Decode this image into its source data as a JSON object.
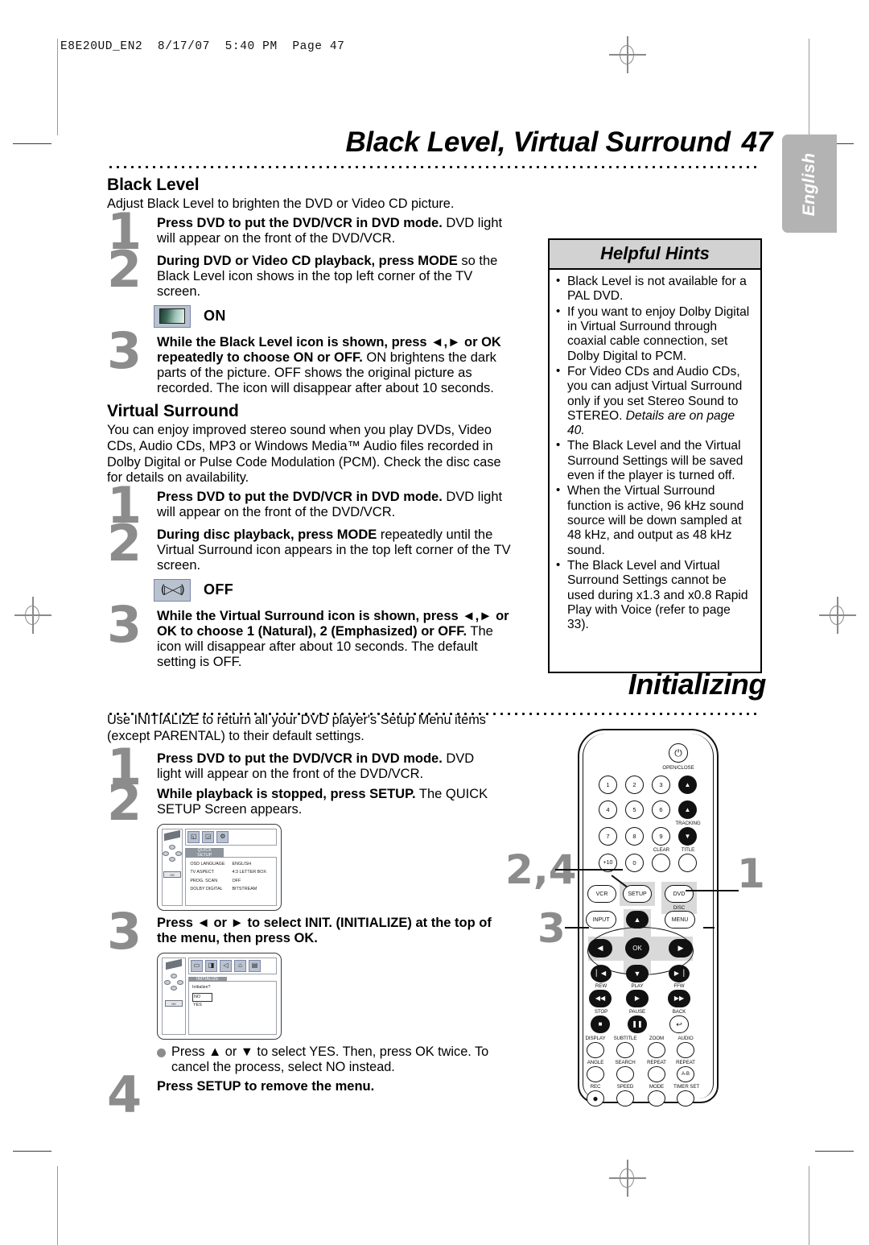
{
  "print_stamp": "E8E20UD_EN2  8/17/07  5:40 PM  Page 47",
  "lang_tab": "English",
  "header": {
    "title": "Black Level, Virtual Surround",
    "page_number": "47"
  },
  "black_level": {
    "heading": "Black Level",
    "intro": "Adjust Black Level to brighten the DVD or Video CD picture.",
    "steps": [
      {
        "num": "1",
        "bold": "Press DVD to put the DVD/VCR in DVD mode.",
        "text": "DVD light will appear on the front of the DVD/VCR."
      },
      {
        "num": "2",
        "bold": "During DVD or Video CD playback, press MODE",
        "text": "so the Black Level icon shows in the top left corner of the TV screen."
      },
      {
        "num": "3",
        "bold": "While the Black Level icon is shown, press ◄,► or OK repeatedly to choose ON or OFF.",
        "text": "ON brightens the dark parts of the picture. OFF shows the original picture as recorded. The icon will disappear after about 10 seconds."
      }
    ],
    "osd_icon_label": "ON",
    "osd_icon_name": "black-level-icon"
  },
  "virtual_surround": {
    "heading": "Virtual Surround",
    "intro": "You can enjoy improved stereo sound when you play DVDs, Video CDs, Audio CDs, MP3 or Windows Media™ Audio files recorded in Dolby Digital or Pulse Code Modulation (PCM). Check the disc case for details on availability.",
    "steps": [
      {
        "num": "1",
        "bold": "Press DVD to put the DVD/VCR in DVD mode.",
        "text": "DVD light will appear on the front of the DVD/VCR."
      },
      {
        "num": "2",
        "bold": "During disc playback, press MODE",
        "text": "repeatedly until the Virtual Surround icon appears in the top left corner of the TV screen."
      },
      {
        "num": "3",
        "bold": "While the Virtual Surround icon is shown, press ◄,► or OK to choose 1 (Natural), 2 (Emphasized) or OFF.",
        "text": "The icon will disappear after about 10 seconds. The default setting is OFF."
      }
    ],
    "osd_icon_label": "OFF",
    "osd_icon_glyph": "(▷◁)"
  },
  "helpful_hints": {
    "title": "Helpful Hints",
    "items": [
      "Black Level is not available for a PAL DVD.",
      "If you want to enjoy Dolby Digital in Virtual Surround through coaxial cable connection, set Dolby Digital to PCM.",
      "For Video CDs and Audio CDs, you can adjust Virtual Surround only if you set Stereo Sound to STEREO.",
      "The Black Level and the Virtual Surround Settings will be saved even if the player is turned off.",
      "When the Virtual Surround function is active, 96 kHz sound source will be down sampled at 48 kHz, and output as 48 kHz sound.",
      "The Black Level and Virtual Surround Settings cannot be used during x1.3 and x0.8 Rapid Play with Voice (refer to page 33)."
    ],
    "italic_note": "Details are on page 40.",
    "italic_note_after_item": 2
  },
  "initializing": {
    "title": "Initializing",
    "intro": "Use INITIALIZE to return all your DVD player's Setup Menu items (except PARENTAL) to their default settings.",
    "steps": [
      {
        "num": "1",
        "bold": "Press DVD to put the DVD/VCR in DVD mode.",
        "text": "DVD light will appear on the front of the DVD/VCR."
      },
      {
        "num": "2",
        "bold": "While playback is stopped, press SETUP.",
        "text": "The QUICK SETUP Screen appears."
      },
      {
        "num": "3",
        "bold": "Press ◄ or ► to select INIT. (INITIALIZE) at the top of the menu, then press OK.",
        "text": ""
      },
      {
        "num": "4",
        "bold": "Press SETUP to remove the menu.",
        "text": ""
      }
    ],
    "bullet_note": "Press ▲ or ▼ to select YES. Then, press OK twice. To cancel the process, select NO instead.",
    "quick_setup_screen": {
      "tab": "QUICK SETUP",
      "icons": [
        "disc",
        "tv-aspect",
        "init"
      ],
      "rows": [
        {
          "label": "OSD LANGUAGE",
          "value": "ENGLISH"
        },
        {
          "label": "TV ASPECT",
          "value": "4:3 LETTER BOX"
        },
        {
          "label": "PROG. SCAN",
          "value": "OFF"
        },
        {
          "label": "DOLBY DIGITAL",
          "value": "BITSTREAM"
        }
      ],
      "ok_label": "OK"
    },
    "initialize_screen": {
      "tab": "INITIALIZE",
      "icons": [
        "display",
        "picture",
        "sound",
        "lock",
        "init"
      ],
      "question": "Initialize?",
      "selected_option": "NO",
      "other_option": "YES",
      "ok_label": "OK"
    }
  },
  "remote": {
    "name": "dvd-vcr-remote-control",
    "power_label": "OPEN/CLOSE",
    "number_keys": [
      "1",
      "2",
      "3",
      "4",
      "5",
      "6",
      "7",
      "8",
      "9",
      "+10",
      "0"
    ],
    "eject_label": "▲",
    "tracking_label": "TRACKING",
    "clear_label": "CLEAR",
    "title_label": "TITLE",
    "source_buttons": [
      "VCR",
      "SETUP",
      "DVD"
    ],
    "disc_menu_label": "DISC",
    "menu_label": "MENU",
    "input_label": "INPUT",
    "ok_label": "OK",
    "transport_labels": [
      "REW",
      "PLAY",
      "FFW"
    ],
    "transport2_labels": [
      "STOP",
      "PAUSE",
      "BACK"
    ],
    "row_display": [
      "DISPLAY",
      "SUBTITLE",
      "ZOOM",
      "AUDIO"
    ],
    "row_angle": [
      "ANGLE",
      "SEARCH",
      "REPEAT",
      "REPEAT"
    ],
    "repeat_ab_label": "A-B",
    "row_rec": [
      "REC",
      "SPEED",
      "MODE",
      "TIMER SET"
    ],
    "callouts": [
      {
        "label": "2,4",
        "target": "setup-button"
      },
      {
        "label": "1",
        "target": "dvd-button"
      },
      {
        "label": "3",
        "target": "arrow-keys"
      }
    ]
  },
  "colors": {
    "step_number_gray": "#8c8c8c",
    "hints_header_gray": "#d2d2d2",
    "lang_tab_gray": "#b3b3b3",
    "osd_chip_blue": "#b9c2cf",
    "remote_highlight": "#d9d9d9"
  }
}
